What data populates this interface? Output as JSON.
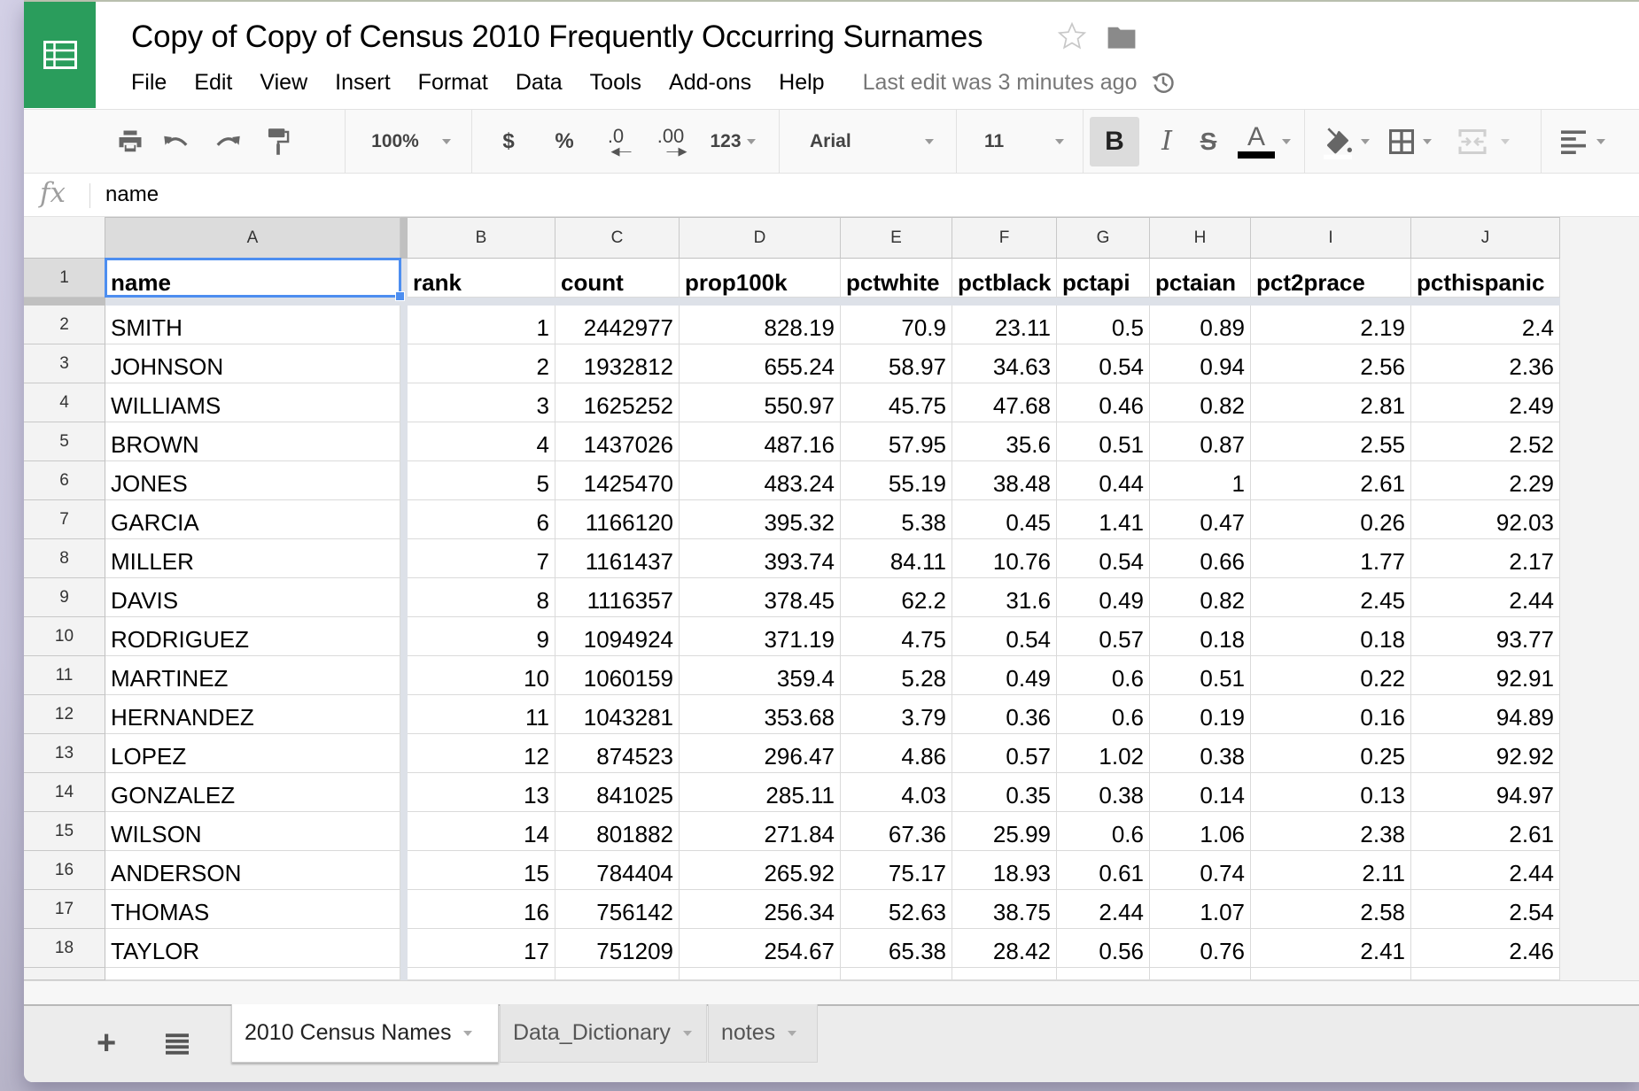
{
  "app": {
    "title": "Copy of Copy of Census 2010 Frequently Occurring Surnames",
    "brand_color": "#2a9d5c",
    "menu": [
      "File",
      "Edit",
      "View",
      "Insert",
      "Format",
      "Data",
      "Tools",
      "Add-ons",
      "Help"
    ],
    "last_edit": "Last edit was 3 minutes ago"
  },
  "toolbar": {
    "zoom": "100%",
    "currency": "$",
    "percent": "%",
    "decrease_decimal": ".0",
    "increase_decimal": ".00",
    "more_formats": "123",
    "font": "Arial",
    "font_size": "11",
    "bold": "B",
    "italic": "I",
    "strikethrough": "S",
    "text_color_label": "A",
    "text_color": "#000000",
    "bold_active": true
  },
  "formula_bar": {
    "fx_label": "fx",
    "value": "name"
  },
  "grid": {
    "columns": [
      "A",
      "B",
      "C",
      "D",
      "E",
      "F",
      "G",
      "H",
      "I",
      "J"
    ],
    "selected_cell": "A1",
    "headers": [
      "name",
      "rank",
      "count",
      "prop100k",
      "pctwhite",
      "pctblack",
      "pctapi",
      "pctaian",
      "pct2prace",
      "pcthispanic"
    ],
    "rows": [
      {
        "n": "2",
        "cells": [
          "SMITH",
          "1",
          "2442977",
          "828.19",
          "70.9",
          "23.11",
          "0.5",
          "0.89",
          "2.19",
          "2.4"
        ]
      },
      {
        "n": "3",
        "cells": [
          "JOHNSON",
          "2",
          "1932812",
          "655.24",
          "58.97",
          "34.63",
          "0.54",
          "0.94",
          "2.56",
          "2.36"
        ]
      },
      {
        "n": "4",
        "cells": [
          "WILLIAMS",
          "3",
          "1625252",
          "550.97",
          "45.75",
          "47.68",
          "0.46",
          "0.82",
          "2.81",
          "2.49"
        ]
      },
      {
        "n": "5",
        "cells": [
          "BROWN",
          "4",
          "1437026",
          "487.16",
          "57.95",
          "35.6",
          "0.51",
          "0.87",
          "2.55",
          "2.52"
        ]
      },
      {
        "n": "6",
        "cells": [
          "JONES",
          "5",
          "1425470",
          "483.24",
          "55.19",
          "38.48",
          "0.44",
          "1",
          "2.61",
          "2.29"
        ]
      },
      {
        "n": "7",
        "cells": [
          "GARCIA",
          "6",
          "1166120",
          "395.32",
          "5.38",
          "0.45",
          "1.41",
          "0.47",
          "0.26",
          "92.03"
        ]
      },
      {
        "n": "8",
        "cells": [
          "MILLER",
          "7",
          "1161437",
          "393.74",
          "84.11",
          "10.76",
          "0.54",
          "0.66",
          "1.77",
          "2.17"
        ]
      },
      {
        "n": "9",
        "cells": [
          "DAVIS",
          "8",
          "1116357",
          "378.45",
          "62.2",
          "31.6",
          "0.49",
          "0.82",
          "2.45",
          "2.44"
        ]
      },
      {
        "n": "10",
        "cells": [
          "RODRIGUEZ",
          "9",
          "1094924",
          "371.19",
          "4.75",
          "0.54",
          "0.57",
          "0.18",
          "0.18",
          "93.77"
        ]
      },
      {
        "n": "11",
        "cells": [
          "MARTINEZ",
          "10",
          "1060159",
          "359.4",
          "5.28",
          "0.49",
          "0.6",
          "0.51",
          "0.22",
          "92.91"
        ]
      },
      {
        "n": "12",
        "cells": [
          "HERNANDEZ",
          "11",
          "1043281",
          "353.68",
          "3.79",
          "0.36",
          "0.6",
          "0.19",
          "0.16",
          "94.89"
        ]
      },
      {
        "n": "13",
        "cells": [
          "LOPEZ",
          "12",
          "874523",
          "296.47",
          "4.86",
          "0.57",
          "1.02",
          "0.38",
          "0.25",
          "92.92"
        ]
      },
      {
        "n": "14",
        "cells": [
          "GONZALEZ",
          "13",
          "841025",
          "285.11",
          "4.03",
          "0.35",
          "0.38",
          "0.14",
          "0.13",
          "94.97"
        ]
      },
      {
        "n": "15",
        "cells": [
          "WILSON",
          "14",
          "801882",
          "271.84",
          "67.36",
          "25.99",
          "0.6",
          "1.06",
          "2.38",
          "2.61"
        ]
      },
      {
        "n": "16",
        "cells": [
          "ANDERSON",
          "15",
          "784404",
          "265.92",
          "75.17",
          "18.93",
          "0.61",
          "0.74",
          "2.11",
          "2.44"
        ]
      },
      {
        "n": "17",
        "cells": [
          "THOMAS",
          "16",
          "756142",
          "256.34",
          "52.63",
          "38.75",
          "2.44",
          "1.07",
          "2.58",
          "2.54"
        ]
      },
      {
        "n": "18",
        "cells": [
          "TAYLOR",
          "17",
          "751209",
          "254.67",
          "65.38",
          "28.42",
          "0.56",
          "0.76",
          "2.41",
          "2.46"
        ]
      }
    ],
    "header_row_number": "1"
  },
  "sheets": {
    "add_label": "+",
    "tabs": [
      {
        "label": "2010 Census Names",
        "active": true
      },
      {
        "label": "Data_Dictionary",
        "active": false
      },
      {
        "label": "notes",
        "active": false
      }
    ]
  }
}
